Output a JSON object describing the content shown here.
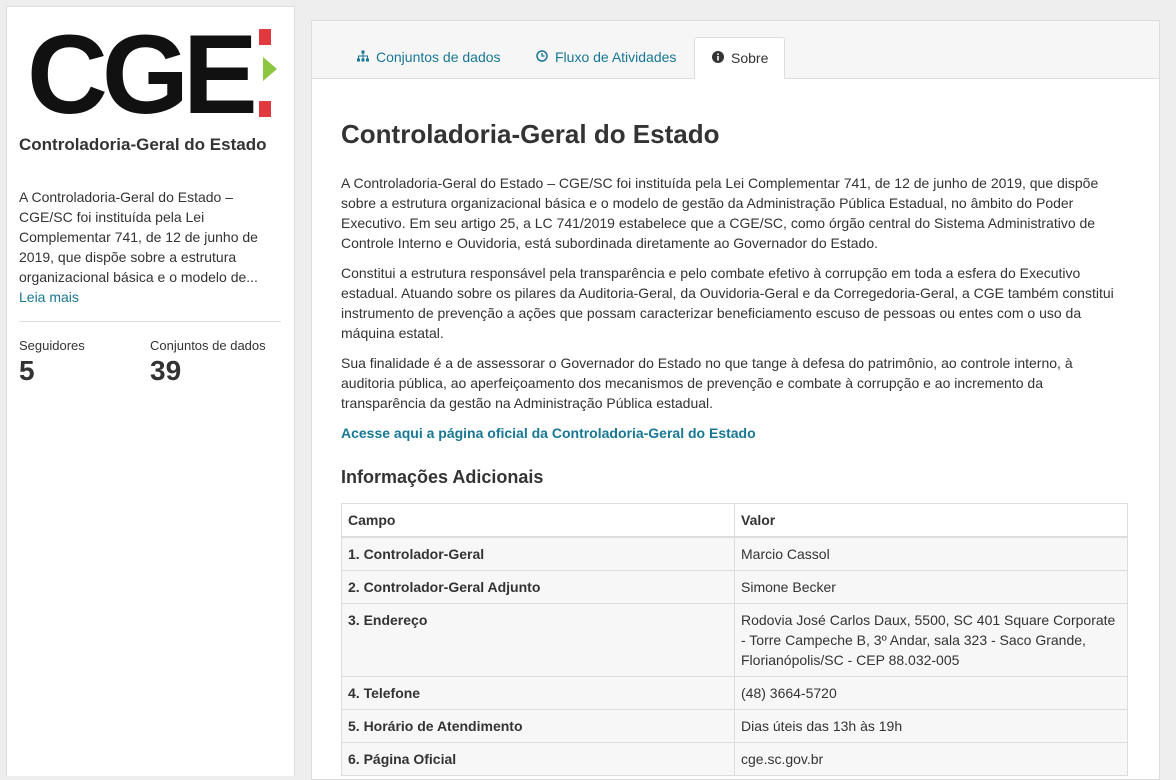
{
  "sidebar": {
    "logo_text": "CGE",
    "org_title": "Controladoria-Geral do Estado",
    "description": "A Controladoria-Geral do Estado – CGE/SC foi instituída pela Lei Complementar 741, de 12 de junho de 2019, que dispõe sobre a estrutura organizacional básica e o modelo de...",
    "read_more": "Leia mais",
    "stats": [
      {
        "label": "Seguidores",
        "value": "5"
      },
      {
        "label": "Conjuntos de dados",
        "value": "39"
      }
    ]
  },
  "tabs": [
    {
      "label": "Conjuntos de dados",
      "icon": "sitemap-icon",
      "active": false
    },
    {
      "label": "Fluxo de Atividades",
      "icon": "clock-icon",
      "active": false
    },
    {
      "label": "Sobre",
      "icon": "info-icon",
      "active": true
    }
  ],
  "main": {
    "title": "Controladoria-Geral do Estado",
    "paragraphs": [
      "A Controladoria-Geral do Estado – CGE/SC foi instituída pela Lei Complementar 741, de 12 de junho de 2019, que dispõe sobre a estrutura organizacional básica e o modelo de gestão da Administração Pública Estadual, no âmbito do Poder Executivo. Em seu artigo 25, a LC 741/2019 estabelece que a CGE/SC, como órgão central do Sistema Administrativo de Controle Interno e Ouvidoria, está subordinada diretamente ao Governador do Estado.",
      "Constitui a estrutura responsável pela transparência e pelo combate efetivo à corrupção em toda a esfera do Executivo estadual. Atuando sobre os pilares da Auditoria-Geral, da Ouvidoria-Geral e da Corregedoria-Geral, a CGE também constitui instrumento de prevenção a ações que possam caracterizar beneficiamento escuso de pessoas ou entes com o uso da máquina estatal.",
      "Sua finalidade é a de assessorar o Governador do Estado no que tange à defesa do patrimônio, ao controle interno, à auditoria pública, ao aperfeiçoamento dos mecanismos de prevenção e combate à corrupção e ao incremento da transparência da gestão na Administração Pública estadual."
    ],
    "official_link": "Acesse aqui a página oficial da Controladoria-Geral do Estado",
    "extra_title": "Informações Adicionais",
    "table_headers": [
      "Campo",
      "Valor"
    ],
    "table_rows": [
      {
        "field": "1. Controlador-Geral",
        "value": "Marcio Cassol"
      },
      {
        "field": "2. Controlador-Geral Adjunto",
        "value": "Simone Becker"
      },
      {
        "field": "3. Endereço",
        "value": "Rodovia José Carlos Daux, 5500, SC 401 Square Corporate - Torre Campeche B, 3º Andar, sala 323 - Saco Grande, Florianópolis/SC - CEP 88.032-005"
      },
      {
        "field": "4. Telefone",
        "value": "(48) 3664-5720"
      },
      {
        "field": "5. Horário de Atendimento",
        "value": "Dias úteis das 13h às 19h"
      },
      {
        "field": "6. Página Oficial",
        "value": "cge.sc.gov.br"
      }
    ]
  },
  "colors": {
    "link": "#187794",
    "logo_red": "#e03a3e",
    "logo_green": "#8dc63f"
  }
}
